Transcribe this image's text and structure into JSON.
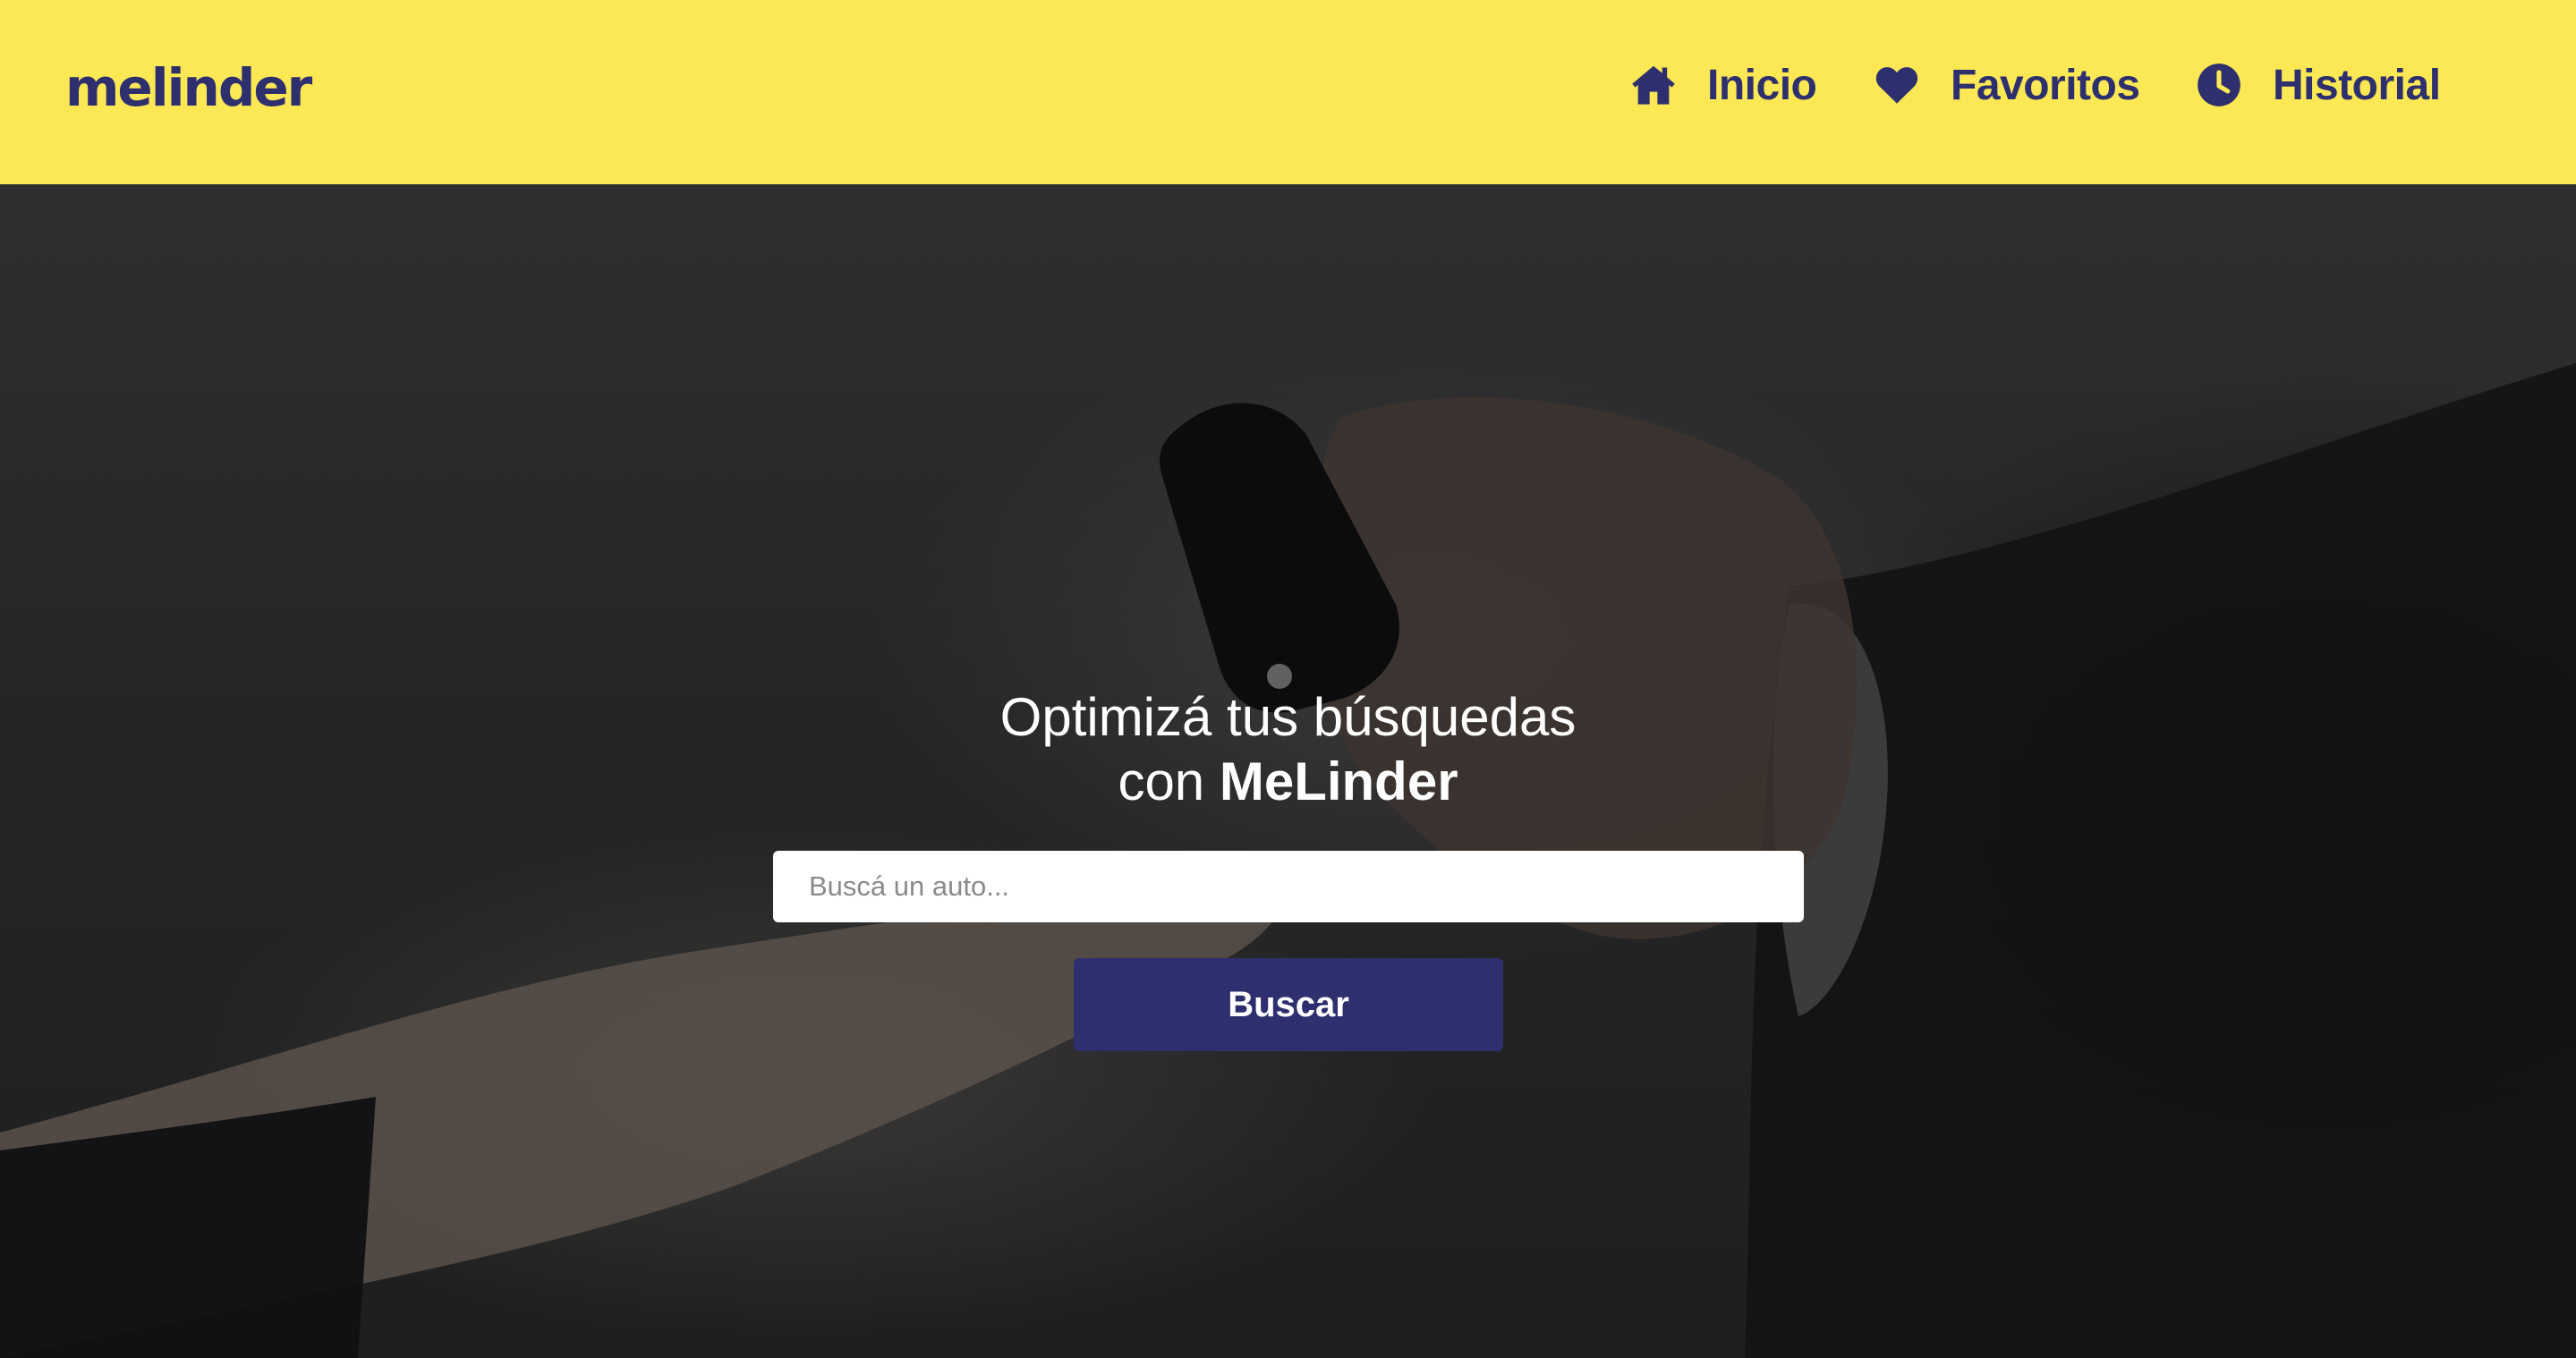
{
  "brand": {
    "logo_text": "melinder",
    "header_color": "#fce854",
    "accent_color": "#2e2f6e"
  },
  "nav": {
    "items": [
      {
        "label": "Inicio",
        "icon": "home-icon"
      },
      {
        "label": "Favoritos",
        "icon": "heart-icon"
      },
      {
        "label": "Historial",
        "icon": "clock-icon"
      }
    ]
  },
  "hero": {
    "title_line1": "Optimizá tus búsquedas",
    "title_line2_prefix": "con ",
    "title_line2_strong": "MeLinder",
    "search": {
      "placeholder": "Buscá un auto...",
      "value": ""
    },
    "button_label": "Buscar",
    "background_image": "hand-passing-car-key-photo"
  }
}
